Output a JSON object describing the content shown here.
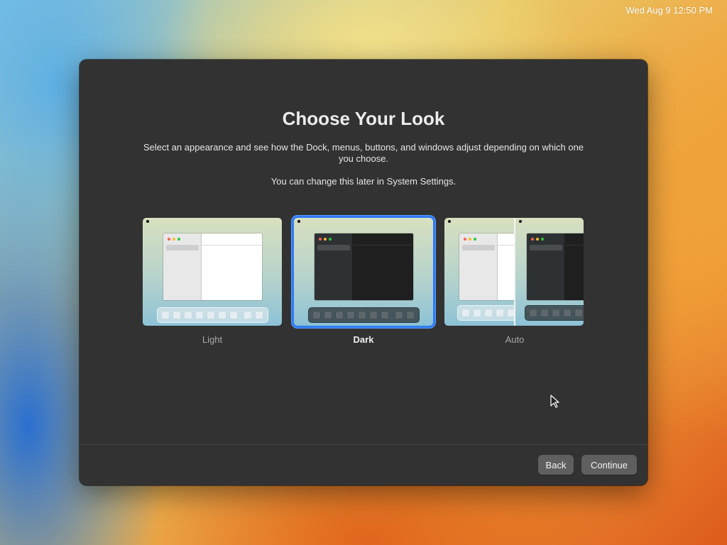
{
  "menubar": {
    "clock": "Wed Aug 9  12:50 PM"
  },
  "dialog": {
    "title": "Choose Your Look",
    "description": "Select an appearance and see how the Dock, menus, buttons, and windows adjust depending on which one you choose.",
    "note": "You can change this later in System Settings.",
    "options": [
      {
        "label": "Light",
        "selected": false
      },
      {
        "label": "Dark",
        "selected": true
      },
      {
        "label": "Auto",
        "selected": false
      }
    ],
    "buttons": {
      "back": "Back",
      "continue": "Continue"
    }
  },
  "colors": {
    "accent": "#2f7bf5",
    "window_bg": "#323232",
    "button_bg": "#5f5f5f"
  },
  "icons": [
    "apple-icon",
    "pointer-cursor-icon"
  ]
}
